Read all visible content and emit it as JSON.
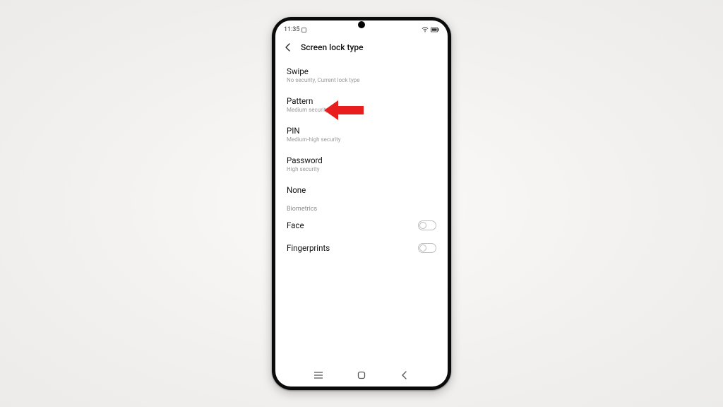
{
  "statusbar": {
    "time": "11:35"
  },
  "header": {
    "title": "Screen lock type"
  },
  "options": {
    "swipe": {
      "label": "Swipe",
      "sub": "No security, Current lock type"
    },
    "pattern": {
      "label": "Pattern",
      "sub": "Medium security"
    },
    "pin": {
      "label": "PIN",
      "sub": "Medium-high security"
    },
    "password": {
      "label": "Password",
      "sub": "High security"
    },
    "none": {
      "label": "None"
    }
  },
  "section": {
    "biometrics": "Biometrics"
  },
  "biometrics": {
    "face": {
      "label": "Face"
    },
    "fingerprints": {
      "label": "Fingerprints"
    }
  }
}
